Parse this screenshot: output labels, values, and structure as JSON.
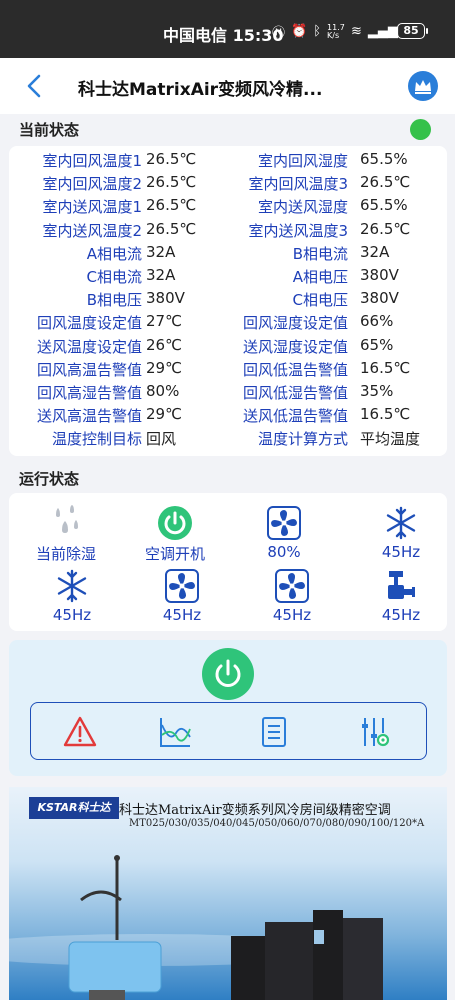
{
  "statusbar": {
    "carrier": "中国电信",
    "time": "15:30",
    "net_speed": "11.7 K/s",
    "battery": "85"
  },
  "header": {
    "title": "科士达MatrixAir变频风冷精..."
  },
  "current_state": {
    "title": "当前状态",
    "rows": [
      {
        "l1": "室内回风温度1",
        "v1": "26.5℃",
        "l2": "室内回风湿度",
        "v2": "65.5%"
      },
      {
        "l1": "室内回风温度2",
        "v1": "26.5℃",
        "l2": "室内回风温度3",
        "v2": "26.5℃"
      },
      {
        "l1": "室内送风温度1",
        "v1": "26.5℃",
        "l2": "室内送风湿度",
        "v2": "65.5%"
      },
      {
        "l1": "室内送风温度2",
        "v1": "26.5℃",
        "l2": "室内送风温度3",
        "v2": "26.5℃"
      },
      {
        "l1": "A相电流",
        "v1": "32A",
        "l2": "B相电流",
        "v2": "32A"
      },
      {
        "l1": "C相电流",
        "v1": "32A",
        "l2": "A相电压",
        "v2": "380V"
      },
      {
        "l1": "B相电压",
        "v1": "380V",
        "l2": "C相电压",
        "v2": "380V"
      },
      {
        "l1": "回风温度设定值",
        "v1": "27℃",
        "l2": "回风湿度设定值",
        "v2": "66%"
      },
      {
        "l1": "送风温度设定值",
        "v1": "26℃",
        "l2": "送风湿度设定值",
        "v2": "65%"
      },
      {
        "l1": "回风高温告警值",
        "v1": "29℃",
        "l2": "回风低温告警值",
        "v2": "16.5℃"
      },
      {
        "l1": "回风高湿告警值",
        "v1": "80%",
        "l2": "回风低湿告警值",
        "v2": "35%"
      },
      {
        "l1": "送风高温告警值",
        "v1": "29℃",
        "l2": "送风低温告警值",
        "v2": "16.5℃"
      },
      {
        "l1": "温度控制目标",
        "v1": "回风",
        "l2": "温度计算方式",
        "v2": "平均温度"
      }
    ]
  },
  "run_state": {
    "title": "运行状态",
    "items": [
      {
        "icon": "dehumidify-icon",
        "label": "当前除湿"
      },
      {
        "icon": "power-on-icon",
        "label": "空调开机"
      },
      {
        "icon": "fan-icon",
        "label": "80%"
      },
      {
        "icon": "snowflake-icon",
        "label": "45Hz"
      },
      {
        "icon": "snowflake-icon",
        "label": "45Hz"
      },
      {
        "icon": "fan-icon",
        "label": "45Hz"
      },
      {
        "icon": "fan-icon",
        "label": "45Hz"
      },
      {
        "icon": "valve-icon",
        "label": "45Hz"
      }
    ]
  },
  "controls": {
    "power_color": "#2fc47a",
    "tools": [
      "alarm-icon",
      "curve-chart-icon",
      "list-icon",
      "settings-sliders-icon"
    ]
  },
  "banner": {
    "logo": "KSTAR科士达",
    "headline": "科士达MatrixAir变频系列风冷房间级精密空调",
    "models": "MT025/030/035/040/045/050/060/070/080/090/100/120*A"
  },
  "colors": {
    "accent": "#1e3fb8",
    "ok_green": "#35c14a",
    "header_blue": "#2a7ed9"
  }
}
